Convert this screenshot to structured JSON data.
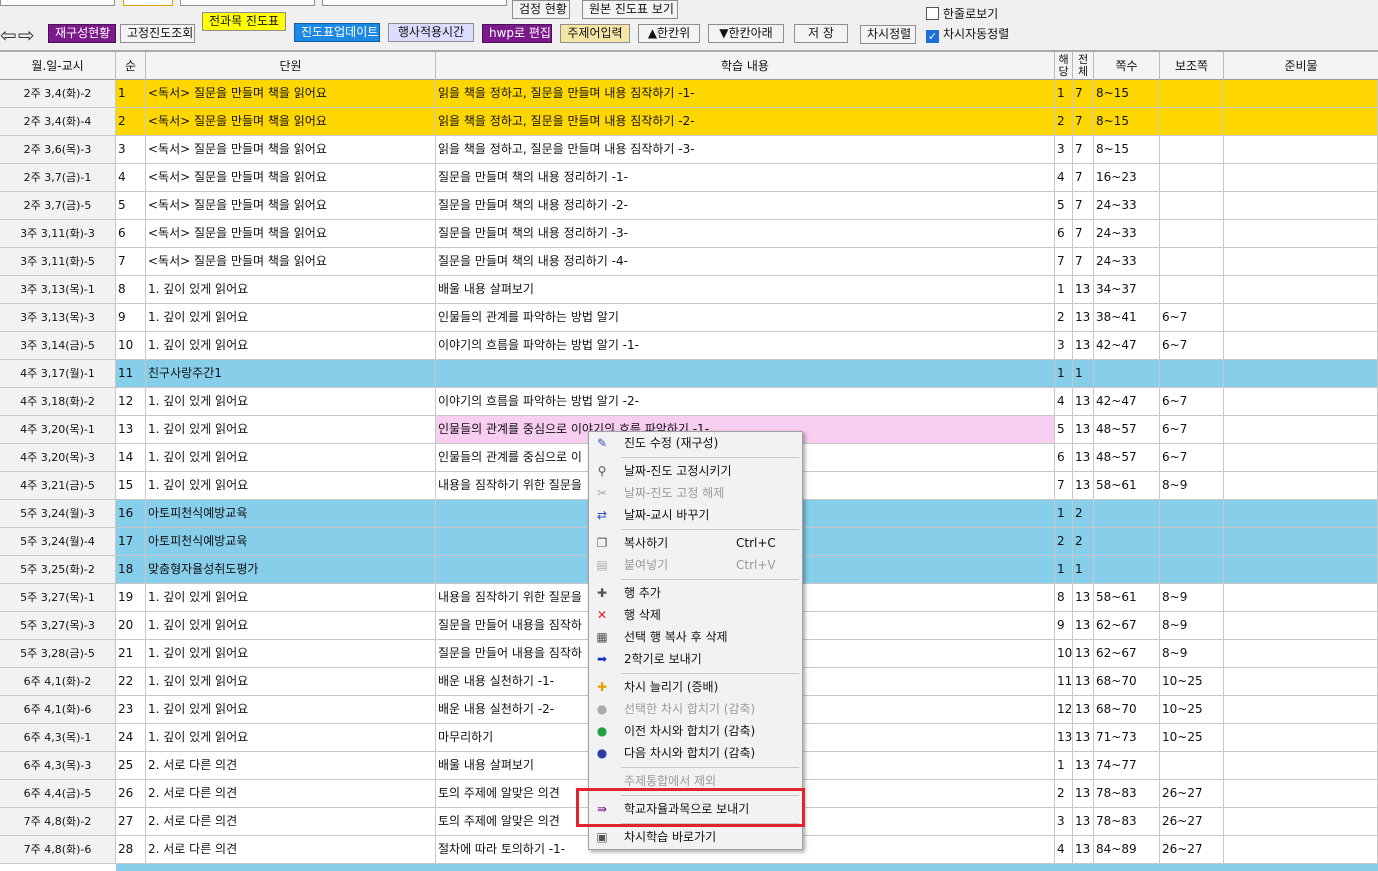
{
  "toolbar": {
    "buttons": {
      "reconstruct": "재구성현황",
      "fixed_view": "고정진도조회",
      "all_subjects": "전과목 진도표",
      "progress_update": "진도표업데이트",
      "event_time": "행사적용시간",
      "hwp_edit": "hwp로 편집",
      "topic_input": "주제어입력",
      "move_up": "▲한칸위",
      "move_down": "▼한칸아래",
      "save": "저 장",
      "period_sort": "차시정렬",
      "test_status": "검정 현황",
      "original_view": "원본 진도표 보기"
    },
    "checkboxes": {
      "single_line": {
        "label": "한줄로보기",
        "checked": false
      },
      "auto_sort": {
        "label": "차시자동정렬",
        "checked": true
      }
    },
    "colors": {
      "purple": "#7b1a8a",
      "yellow": "#ffff00",
      "blue": "#1e88e5"
    }
  },
  "grid": {
    "headers": {
      "date": "월.일-교시",
      "seq": "순",
      "unit": "단원",
      "content": "학습 내용",
      "cur": "해당",
      "total": "전체",
      "page": "쪽수",
      "sub_page": "보조쪽",
      "prep": "준비물"
    },
    "rows": [
      {
        "date": "2주 3,4(화)-2",
        "seq": "1",
        "unit": "<독서> 질문을 만들며 책을 읽어요",
        "content": "읽을 책을 정하고, 질문을 만들며 내용 짐작하기 -1-",
        "cur": "1",
        "total": "7",
        "page": "8~15",
        "sub": "",
        "prep": ""
      },
      {
        "date": "2주 3,4(화)-4",
        "seq": "2",
        "unit": "<독서> 질문을 만들며 책을 읽어요",
        "content": "읽을 책을 정하고, 질문을 만들며 내용 짐작하기 -2-",
        "cur": "2",
        "total": "7",
        "page": "8~15",
        "sub": "",
        "prep": ""
      },
      {
        "date": "2주 3,6(목)-3",
        "seq": "3",
        "unit": "<독서> 질문을 만들며 책을 읽어요",
        "content": "읽을 책을 정하고, 질문을 만들며 내용 짐작하기 -3-",
        "cur": "3",
        "total": "7",
        "page": "8~15",
        "sub": "",
        "prep": ""
      },
      {
        "date": "2주 3,7(금)-1",
        "seq": "4",
        "unit": "<독서> 질문을 만들며 책을 읽어요",
        "content": "질문을 만들며 책의 내용 정리하기 -1-",
        "cur": "4",
        "total": "7",
        "page": "16~23",
        "sub": "",
        "prep": ""
      },
      {
        "date": "2주 3,7(금)-5",
        "seq": "5",
        "unit": "<독서> 질문을 만들며 책을 읽어요",
        "content": "질문을 만들며 책의 내용 정리하기 -2-",
        "cur": "5",
        "total": "7",
        "page": "24~33",
        "sub": "",
        "prep": ""
      },
      {
        "date": "3주 3,11(화)-3",
        "seq": "6",
        "unit": "<독서> 질문을 만들며 책을 읽어요",
        "content": "질문을 만들며 책의 내용 정리하기 -3-",
        "cur": "6",
        "total": "7",
        "page": "24~33",
        "sub": "",
        "prep": ""
      },
      {
        "date": "3주 3,11(화)-5",
        "seq": "7",
        "unit": "<독서> 질문을 만들며 책을 읽어요",
        "content": "질문을 만들며 책의 내용 정리하기 -4-",
        "cur": "7",
        "total": "7",
        "page": "24~33",
        "sub": "",
        "prep": ""
      },
      {
        "date": "3주 3,13(목)-1",
        "seq": "8",
        "unit": "1. 깊이 있게 읽어요",
        "content": "배울 내용 살펴보기",
        "cur": "1",
        "total": "13",
        "page": "34~37",
        "sub": "",
        "prep": ""
      },
      {
        "date": "3주 3,13(목)-3",
        "seq": "9",
        "unit": "1. 깊이 있게 읽어요",
        "content": "인물들의 관계를 파악하는 방법 알기",
        "cur": "2",
        "total": "13",
        "page": "38~41",
        "sub": "6~7",
        "prep": ""
      },
      {
        "date": "3주 3,14(금)-5",
        "seq": "10",
        "unit": "1. 깊이 있게 읽어요",
        "content": "이야기의 흐름을 파악하는 방법 알기 -1-",
        "cur": "3",
        "total": "13",
        "page": "42~47",
        "sub": "6~7",
        "prep": ""
      },
      {
        "date": "4주 3,17(월)-1",
        "seq": "11",
        "unit": "친구사랑주간1",
        "content": "",
        "cur": "1",
        "total": "1",
        "page": "",
        "sub": "",
        "prep": ""
      },
      {
        "date": "4주 3,18(화)-2",
        "seq": "12",
        "unit": "1. 깊이 있게 읽어요",
        "content": "이야기의 흐름을 파악하는 방법 알기 -2-",
        "cur": "4",
        "total": "13",
        "page": "42~47",
        "sub": "6~7",
        "prep": ""
      },
      {
        "date": "4주 3,20(목)-1",
        "seq": "13",
        "unit": "1. 깊이 있게 읽어요",
        "content": "인물들의 관계를 중심으로 이야기의 흐름 파악하기 -1-",
        "cur": "5",
        "total": "13",
        "page": "48~57",
        "sub": "6~7",
        "prep": ""
      },
      {
        "date": "4주 3,20(목)-3",
        "seq": "14",
        "unit": "1. 깊이 있게 읽어요",
        "content": "인물들의 관계를 중심으로 이",
        "cur": "6",
        "total": "13",
        "page": "48~57",
        "sub": "6~7",
        "prep": ""
      },
      {
        "date": "4주 3,21(금)-5",
        "seq": "15",
        "unit": "1. 깊이 있게 읽어요",
        "content": "내용을 짐작하기 위한 질문을",
        "cur": "7",
        "total": "13",
        "page": "58~61",
        "sub": "8~9",
        "prep": ""
      },
      {
        "date": "5주 3,24(월)-3",
        "seq": "16",
        "unit": "아토피천식예방교육",
        "content": "",
        "cur": "1",
        "total": "2",
        "page": "",
        "sub": "",
        "prep": ""
      },
      {
        "date": "5주 3,24(월)-4",
        "seq": "17",
        "unit": "아토피천식예방교육",
        "content": "",
        "cur": "2",
        "total": "2",
        "page": "",
        "sub": "",
        "prep": ""
      },
      {
        "date": "5주 3,25(화)-2",
        "seq": "18",
        "unit": "맞춤형자율성취도평가",
        "content": "",
        "cur": "1",
        "total": "1",
        "page": "",
        "sub": "",
        "prep": ""
      },
      {
        "date": "5주 3,27(목)-1",
        "seq": "19",
        "unit": "1. 깊이 있게 읽어요",
        "content": "내용을 짐작하기 위한 질문을",
        "cur": "8",
        "total": "13",
        "page": "58~61",
        "sub": "8~9",
        "prep": ""
      },
      {
        "date": "5주 3,27(목)-3",
        "seq": "20",
        "unit": "1. 깊이 있게 읽어요",
        "content": "질문을 만들어 내용을 짐작하",
        "cur": "9",
        "total": "13",
        "page": "62~67",
        "sub": "8~9",
        "prep": ""
      },
      {
        "date": "5주 3,28(금)-5",
        "seq": "21",
        "unit": "1. 깊이 있게 읽어요",
        "content": "질문을 만들어 내용을 짐작하",
        "cur": "10",
        "total": "13",
        "page": "62~67",
        "sub": "8~9",
        "prep": ""
      },
      {
        "date": "6주 4,1(화)-2",
        "seq": "22",
        "unit": "1. 깊이 있게 읽어요",
        "content": "배운 내용 실천하기 -1-",
        "cur": "11",
        "total": "13",
        "page": "68~70",
        "sub": "10~25",
        "prep": ""
      },
      {
        "date": "6주 4,1(화)-6",
        "seq": "23",
        "unit": "1. 깊이 있게 읽어요",
        "content": "배운 내용 실천하기 -2-",
        "cur": "12",
        "total": "13",
        "page": "68~70",
        "sub": "10~25",
        "prep": ""
      },
      {
        "date": "6주 4,3(목)-1",
        "seq": "24",
        "unit": "1. 깊이 있게 읽어요",
        "content": "마무리하기",
        "cur": "13",
        "total": "13",
        "page": "71~73",
        "sub": "10~25",
        "prep": ""
      },
      {
        "date": "6주 4,3(목)-3",
        "seq": "25",
        "unit": "2. 서로 다른 의견",
        "content": "배울 내용 살펴보기",
        "cur": "1",
        "total": "13",
        "page": "74~77",
        "sub": "",
        "prep": ""
      },
      {
        "date": "6주 4,4(금)-5",
        "seq": "26",
        "unit": "2. 서로 다른 의견",
        "content": "토의 주제에 알맞은 의견",
        "cur": "2",
        "total": "13",
        "page": "78~83",
        "sub": "26~27",
        "prep": ""
      },
      {
        "date": "7주 4,8(화)-2",
        "seq": "27",
        "unit": "2. 서로 다른 의견",
        "content": "토의 주제에 알맞은 의견",
        "cur": "3",
        "total": "13",
        "page": "78~83",
        "sub": "26~27",
        "prep": ""
      },
      {
        "date": "7주 4,8(화)-6",
        "seq": "28",
        "unit": "2. 서로 다른 의견",
        "content": "절차에 따라 토의하기 -1-",
        "cur": "4",
        "total": "13",
        "page": "84~89",
        "sub": "26~27",
        "prep": ""
      }
    ],
    "row_colors": {
      "yellow": "#ffd700",
      "blue": "#87ceeb",
      "selected": "#f7cdf0"
    }
  },
  "context_menu": {
    "items": [
      {
        "label": "진도 수정 (재구성)",
        "shortcut": "",
        "disabled": false,
        "icon": "edit-icon"
      },
      {
        "label": "날짜-진도 고정시키기",
        "shortcut": "",
        "disabled": false,
        "icon": "pin-icon"
      },
      {
        "label": "날짜-진도 고정 해제",
        "shortcut": "",
        "disabled": true,
        "icon": "unpin-icon"
      },
      {
        "label": "날짜-교시 바꾸기",
        "shortcut": "",
        "disabled": false,
        "icon": "swap-icon"
      },
      {
        "label": "복사하기",
        "shortcut": "Ctrl+C",
        "disabled": false,
        "icon": "copy-icon"
      },
      {
        "label": "붙여넣기",
        "shortcut": "Ctrl+V",
        "disabled": true,
        "icon": "paste-icon"
      },
      {
        "label": "행 추가",
        "shortcut": "",
        "disabled": false,
        "icon": "add-row-icon"
      },
      {
        "label": "행 삭제",
        "shortcut": "",
        "disabled": false,
        "icon": "delete-icon"
      },
      {
        "label": "선택 행 복사 후 삭제",
        "shortcut": "",
        "disabled": false,
        "icon": "cut-icon"
      },
      {
        "label": "2학기로 보내기",
        "shortcut": "",
        "disabled": false,
        "icon": "arrow-right-icon"
      },
      {
        "label": "차시 늘리기 (증배)",
        "shortcut": "",
        "disabled": false,
        "icon": "plus-icon"
      },
      {
        "label": "선택한 차시 합치기 (감축)",
        "shortcut": "",
        "disabled": true,
        "icon": "merge-icon"
      },
      {
        "label": "이전 차시와 합치기 (감축)",
        "shortcut": "",
        "disabled": false,
        "icon": "merge-prev-icon"
      },
      {
        "label": "다음 차시와 합치기 (감축)",
        "shortcut": "",
        "disabled": false,
        "icon": "merge-next-icon"
      },
      {
        "label": "주제통합에서 제외",
        "shortcut": "",
        "disabled": true,
        "icon": ""
      },
      {
        "label": "학교자율과목으로 보내기",
        "shortcut": "",
        "disabled": false,
        "icon": "send-icon"
      },
      {
        "label": "차시학습 바로가기",
        "shortcut": "",
        "disabled": false,
        "icon": "shortcut-icon"
      }
    ],
    "highlight_color": "#e3242b"
  }
}
